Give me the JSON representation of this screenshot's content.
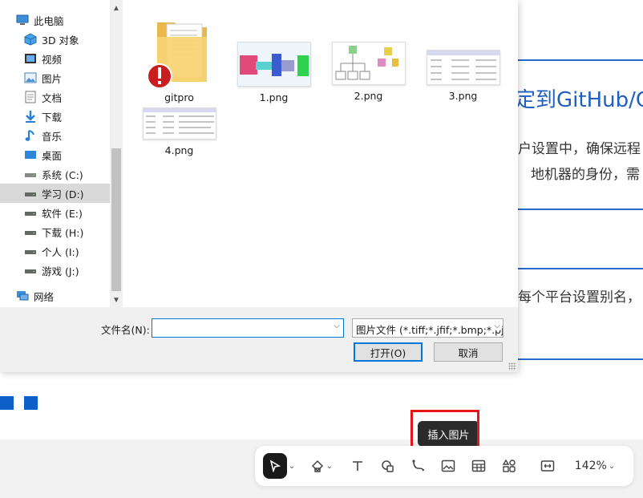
{
  "document": {
    "heading": "定到GitHub/C",
    "line1": "户设置中，确保远程",
    "line2": "地机器的身份，需",
    "line3": "每个平台设置别名，",
    "accent_color": "#2a6bc9"
  },
  "dialog": {
    "nav_items": [
      {
        "label": "此电脑",
        "icon": "pc-icon"
      },
      {
        "label": "3D 对象",
        "icon": "cube-icon"
      },
      {
        "label": "视频",
        "icon": "video-icon"
      },
      {
        "label": "图片",
        "icon": "picture-icon"
      },
      {
        "label": "文档",
        "icon": "document-icon"
      },
      {
        "label": "下载",
        "icon": "download-icon"
      },
      {
        "label": "音乐",
        "icon": "music-icon"
      },
      {
        "label": "桌面",
        "icon": "desktop-icon"
      },
      {
        "label": "系统 (C:)",
        "icon": "drive-icon"
      },
      {
        "label": "学习 (D:)",
        "icon": "drive-icon",
        "selected": true
      },
      {
        "label": "软件 (E:)",
        "icon": "drive-icon"
      },
      {
        "label": "下载 (H:)",
        "icon": "drive-icon"
      },
      {
        "label": "个人 (I:)",
        "icon": "drive-icon"
      },
      {
        "label": "游戏 (J:)",
        "icon": "drive-icon"
      },
      {
        "label": "网络",
        "icon": "network-icon"
      }
    ],
    "files": [
      {
        "name": "gitpro",
        "kind": "folder"
      },
      {
        "name": "1.png",
        "kind": "image"
      },
      {
        "name": "2.png",
        "kind": "image"
      },
      {
        "name": "3.png",
        "kind": "image"
      },
      {
        "name": "4.png",
        "kind": "image"
      }
    ],
    "filename_label": "文件名(N):",
    "filename_value": "",
    "filetype_value": "图片文件 (*.tiff;*.jfif;*.bmp;*.pj",
    "open_button": "打开(O)",
    "cancel_button": "取消"
  },
  "toolbar": {
    "tooltip": "插入图片",
    "zoom": "142%",
    "tools": [
      "select-tool",
      "shape-tool",
      "text-tool",
      "shapes-tool",
      "connector-tool",
      "image-tool",
      "table-tool",
      "component-tool",
      "fit-width-tool"
    ],
    "highlight_color": "#e8141c"
  }
}
